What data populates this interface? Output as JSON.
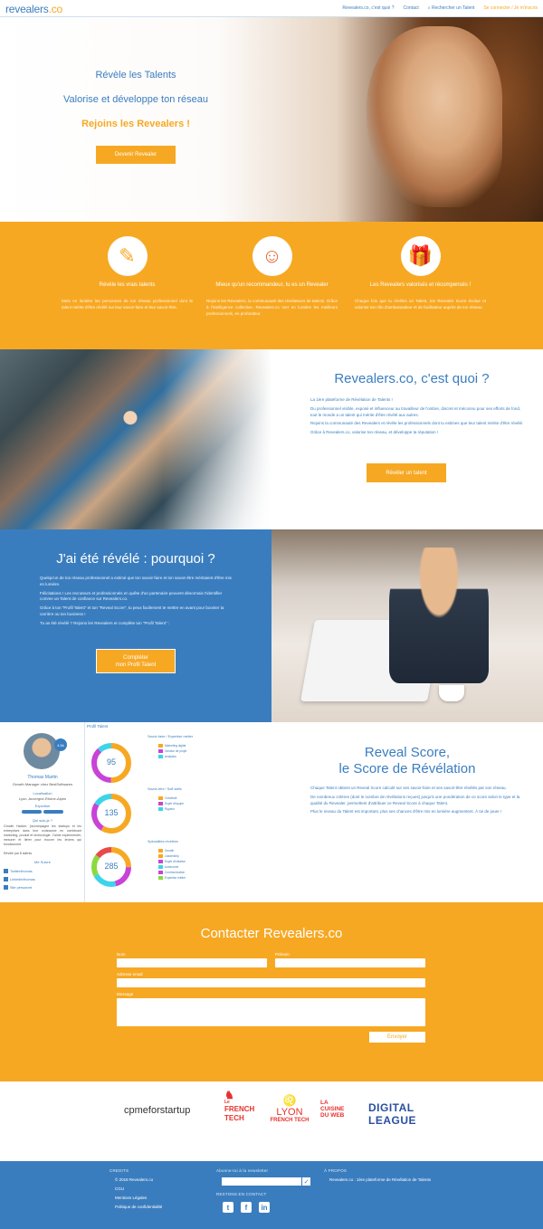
{
  "header": {
    "logo_main": "revealers",
    "logo_dot": ".co",
    "nav": {
      "about": "Revealers.co, c'est quoi ?",
      "contact": "Contact",
      "search": "Rechercher un Talent",
      "login": "Se connecter",
      "separator": "/",
      "signup": "Je m'inscris"
    }
  },
  "hero": {
    "line1": "Révèle les Talents",
    "line2": "Valorise et développe ton réseau",
    "line3": "Rejoins les Revealers !",
    "button": "Devenir Revealer"
  },
  "features": [
    {
      "icon": "✎",
      "title": "Révèle les vrais talents",
      "text": "Mets en lumière les personnes de ton réseau professionnel dont le talent mérite d'être révélé sur leur savoir-faire et leur savoir-être."
    },
    {
      "icon": "☺",
      "title": "Mieux qu'un recommandeur, tu es un Revealer",
      "text": "Rejoins les Revealers, la communauté des révélateurs de talents. Grâce à l'intelligence collective, Revealers.co met en lumière les meilleurs professionnels, en profondeur."
    },
    {
      "icon": "🎁",
      "title": "Les Revealers valorisés et récompensés !",
      "text": "Chaque fois que tu révèles un Talent, ton Revealer Score évolue et valorise ton rôle d'ambassadeur et de facilitateur auprès de ton réseau."
    }
  ],
  "about": {
    "title": "Revealers.co, c'est quoi ?",
    "paragraphs": [
      "La 1ère plateforme de Révélation de Talents !",
      "Du professionnel visible, exposé et influenceur au travailleur de l'ombre, discret et méconnu pour ses efforts de fond, tout le monde a un talent qui mérite d'être révélé aux autres.",
      "Rejoins la communauté des Revealers et révèle les professionnels dont tu estimes que leur talent mérite d'être révélé.",
      "Grâce à Revealers.co, valorise ton réseau, et développe ta réputation !"
    ],
    "button": "Révéler un talent"
  },
  "why": {
    "title": "J'ai été révélé : pourquoi ?",
    "paragraphs": [
      "Quelqu'un de ton réseau professionnel a estimé que ton savoir-faire et ton savoir-être méritaient d'être mis en lumière.",
      "Félicitations ! Les recruteurs et professionnels en quête d'un partenaire peuvent désormais t'identifier comme un Talent de confiance sur Revealers.co.",
      "Grâce à ton \"Profil Talent\" et ton \"Reveal Score\", tu peux facilement te mettre en avant pour booster ta carrière ou ton business !",
      "Tu as été révélé ? Rejoins les Revealers et complète ton \"Profil Talent\" :"
    ],
    "button_line1": "Compléter",
    "button_line2": "mon Profil Talent"
  },
  "score": {
    "profile": {
      "badge": "4.5k",
      "name": "Thomas Martin",
      "role": "Growth Manager chez BestSoftwares",
      "location_label": "Localisation",
      "location": "Lyon, Auvergne-Rhône-Alpes",
      "expertise_label": "Expertise",
      "who_label": "Qui suis-je ?",
      "bio": "Growth Hacker, j'accompagne les startups et les entreprises dans leur croissance en combinant marketing, produit et technologie. J'aime expérimenter, mesurer et itérer pour trouver les leviers qui fonctionnent.",
      "revealed_by": "Révélé par 8 talents",
      "follow_label": "Me Suivre",
      "links": [
        "Twitter/thomas",
        "Linkedin/thomas",
        "Site personnel"
      ]
    },
    "tab_label": "Profil Talent",
    "donuts": [
      95,
      135,
      285
    ],
    "legend_groups": [
      {
        "title": "Savoir-faire / Expertise métier",
        "items": [
          "Marketing digital",
          "Gestion de projet",
          "Analytics"
        ]
      },
      {
        "title": "Savoir-être / Soft skills",
        "items": [
          "Créativité",
          "Esprit d'équipe",
          "Rigueur"
        ]
      },
      {
        "title": "Spécialités révélées",
        "items": [
          "Growth",
          "Leadership",
          "Esprit d'initiative",
          "Autonomie",
          "Communication",
          "Expertise métier"
        ]
      }
    ],
    "colors": [
      "#f7a823",
      "#c843d6",
      "#3dd4e8",
      "#8cd940"
    ],
    "title_line1": "Reveal Score,",
    "title_line2": "le Score de Révélation",
    "paragraphs": [
      "Chaque Talent obtient un Reveal Score calculé sur ses savoir-faire et ses savoir-être révélés par son réseau.",
      "De nombreux critères (dont le nombre de révélations reçues) jusqu'à une pondération de ce score selon le type et la qualité du Revealer, permettent d'attribuer ce Reveal Score à chaque Talent.",
      "Plus le niveau du Talent est important, plus ses chances d'être mis en lumière augmentent. À toi de jouer !"
    ]
  },
  "contact": {
    "title": "Contacter Revealers.co",
    "name_label": "Nom",
    "firstname_label": "Prénom",
    "email_label": "Adresse email",
    "message_label": "Message",
    "send": "Envoyer"
  },
  "partners": {
    "cpme": "cpmeforstartup",
    "frenchtech_le": "Le",
    "frenchtech_french": "FRENCH",
    "frenchtech_tech": "TECH",
    "lyon_top": "LYON",
    "lyon_bottom": "FRENCH TECH",
    "cuisine": "LA CUISINE DU WEB",
    "digital1": "DIGITAL",
    "digital2": "LEAGUE"
  },
  "footer": {
    "credits_title": "CREDITS",
    "credits_items": [
      "© 2018 Revealers.co",
      "CGU",
      "Mentions Légales",
      "Politique de confidentialité"
    ],
    "newsletter_title": "Abonne-toi à la newsletter",
    "contact_title": "RESTONS EN CONTACT",
    "about_title": "À PROPOS",
    "about_text": "Revealers.co : 1ère plateforme de Révélation de Talents"
  }
}
